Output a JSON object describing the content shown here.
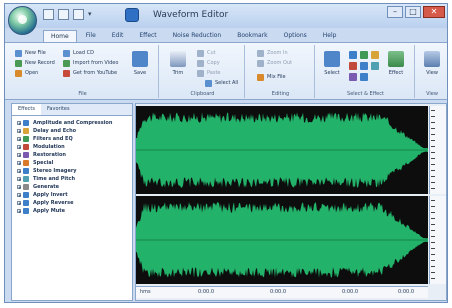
{
  "window": {
    "title": "Waveform Editor",
    "buttons": {
      "minimize": "–",
      "maximize": "□",
      "close": "✕"
    }
  },
  "quick_access": [
    "save-icon",
    "undo-icon",
    "redo-icon"
  ],
  "ribbon": {
    "tabs": [
      "Home",
      "File",
      "Edit",
      "Effect",
      "Noise Reduction",
      "Bookmark",
      "Options",
      "Help"
    ],
    "active_tab": "Home",
    "groups": {
      "file": {
        "label": "File",
        "buttons": [
          "New File",
          "New Record",
          "Open",
          "Load CD",
          "Import from Video",
          "Get from YouTube"
        ],
        "big_button": "Save"
      },
      "clipboard": {
        "label": "Clipboard",
        "buttons": [
          "Cut",
          "Copy",
          "Paste",
          "Select All"
        ],
        "big_button": "Trim"
      },
      "editing": {
        "label": "Editing",
        "buttons": [
          "Zoom In",
          "Zoom Out",
          "Mix File"
        ]
      },
      "select_effect": {
        "label": "Select & Effect",
        "big_buttons": [
          "Select",
          "Effect"
        ]
      },
      "view": {
        "label": "View",
        "big_button": "View"
      }
    }
  },
  "effects_panel": {
    "tabs": [
      "Effects",
      "Favorites"
    ],
    "active_tab": "Effects",
    "items": [
      {
        "label": "Amplitude and Compression",
        "color": "#3d7fc9"
      },
      {
        "label": "Delay and Echo",
        "color": "#d8a43a"
      },
      {
        "label": "Filters and EQ",
        "color": "#3f9a55"
      },
      {
        "label": "Modulation",
        "color": "#c24a3a"
      },
      {
        "label": "Restoration",
        "color": "#7a5ab0"
      },
      {
        "label": "Special",
        "color": "#d87a2a"
      },
      {
        "label": "Stereo Imagery",
        "color": "#3d7fc9"
      },
      {
        "label": "Time and Pitch",
        "color": "#4fa0b0"
      },
      {
        "label": "Generate",
        "color": "#8a8a8a"
      },
      {
        "label": "Apply Invert",
        "color": "#3d7fc9"
      },
      {
        "label": "Apply Reverse",
        "color": "#3d7fc9"
      },
      {
        "label": "Apply Mute",
        "color": "#3d7fc9"
      }
    ]
  },
  "timeline": {
    "labels": [
      "hms",
      "0:00.0",
      "0:00.0",
      "0:00.0",
      "0:00.0"
    ]
  },
  "colors": {
    "waveform": "#23b26a",
    "waveform_bg": "#0d0d0d",
    "accent": "#4f86c9"
  }
}
